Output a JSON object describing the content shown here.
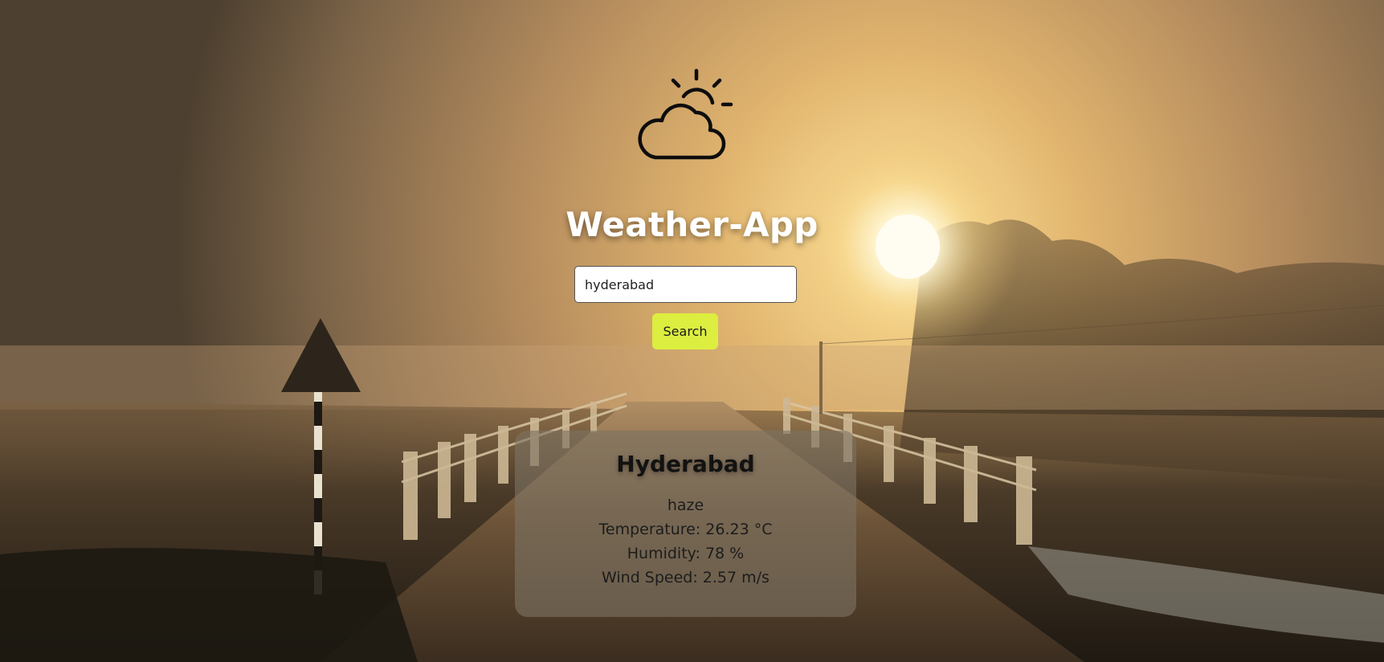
{
  "app": {
    "title": "Weather-App",
    "icon": "partly-cloudy-icon"
  },
  "search": {
    "value": "hyderabad",
    "button_label": "Search"
  },
  "result": {
    "city": "Hyderabad",
    "description": "haze",
    "temperature": "Temperature: 26.23 °C",
    "humidity": "Humidity: 78 %",
    "wind_speed": "Wind Speed: 2.57 m/s"
  },
  "colors": {
    "button_bg": "#dcee3f",
    "title_text": "#ffffff",
    "card_bg": "rgba(125,115,98,0.62)"
  }
}
